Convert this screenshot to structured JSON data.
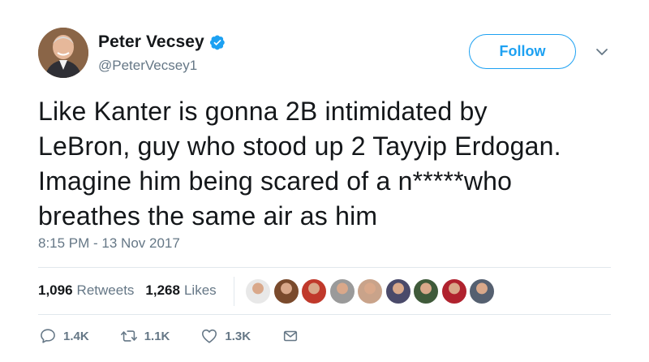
{
  "user": {
    "display_name": "Peter Vecsey",
    "handle": "@PeterVecsey1",
    "verified": true,
    "avatar_icon": "profile-photo"
  },
  "header": {
    "follow_label": "Follow",
    "menu_icon": "chevron-down-icon"
  },
  "tweet": {
    "lines": [
      "Like Kanter is gonna 2B intimidated by",
      "LeBron, guy who stood up 2 Tayyip Erdogan.",
      "Imagine him being scared of a n*****who",
      "breathes the same air as him"
    ],
    "timestamp": "8:15 PM - 13 Nov 2017"
  },
  "stats": {
    "retweets_count": "1,096",
    "retweets_label": "Retweets",
    "likes_count": "1,268",
    "likes_label": "Likes"
  },
  "likers": [
    {
      "icon": "liker-avatar",
      "color": "#e8e8e8"
    },
    {
      "icon": "liker-avatar",
      "color": "#7a4a2c"
    },
    {
      "icon": "liker-avatar",
      "color": "#c0392b"
    },
    {
      "icon": "liker-avatar",
      "color": "#9a9a9a"
    },
    {
      "icon": "liker-avatar",
      "color": "#c9a38a"
    },
    {
      "icon": "liker-avatar",
      "color": "#4a4a6a"
    },
    {
      "icon": "liker-avatar",
      "color": "#3f5a3a"
    },
    {
      "icon": "liker-avatar",
      "color": "#b0222e"
    },
    {
      "icon": "liker-avatar",
      "color": "#556070"
    }
  ],
  "actions": {
    "reply_count": "1.4K",
    "retweet_count": "1.1K",
    "like_count": "1.3K"
  },
  "colors": {
    "accent": "#1da1f2",
    "text": "#14171a",
    "muted": "#657786",
    "divider": "#e1e8ed"
  }
}
